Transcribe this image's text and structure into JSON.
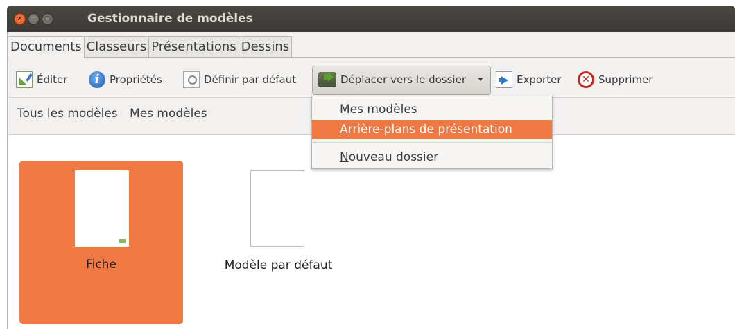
{
  "window": {
    "title": "Gestionnaire de modèles"
  },
  "tabs": [
    {
      "label": "Documents",
      "active": true
    },
    {
      "label": "Classeurs",
      "active": false
    },
    {
      "label": "Présentations",
      "active": false
    },
    {
      "label": "Dessins",
      "active": false
    }
  ],
  "toolbar": {
    "edit": "Éditer",
    "properties": "Propriétés",
    "set_default": "Définir par défaut",
    "move_to_folder": "Déplacer vers le dossier",
    "export": "Exporter",
    "delete": "Supprimer"
  },
  "filters": {
    "all": "Tous les modèles",
    "mine": "Mes modèles"
  },
  "templates": [
    {
      "label": "Fiche",
      "selected": true
    },
    {
      "label": "Modèle par défaut",
      "selected": false
    }
  ],
  "menu": {
    "items": [
      {
        "mnemonic": "M",
        "rest": "es modèles",
        "highlighted": false
      },
      {
        "mnemonic": "A",
        "rest": "rrière-plans de présentation",
        "highlighted": true
      },
      {
        "mnemonic": "N",
        "rest": "ouveau dossier",
        "highlighted": false
      }
    ]
  },
  "colors": {
    "accent": "#f07843",
    "titlebar": "#3b3a36",
    "chrome": "#f2f1f0"
  }
}
